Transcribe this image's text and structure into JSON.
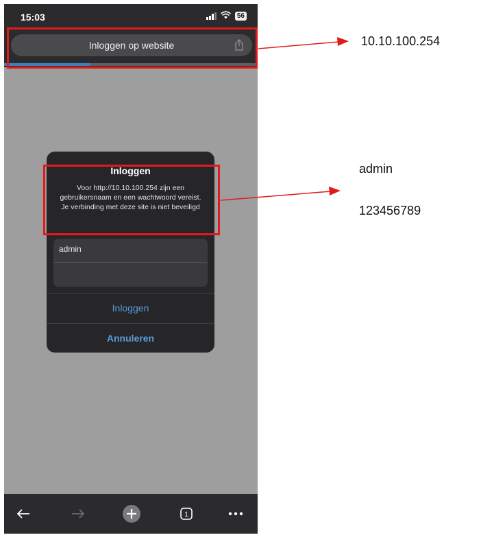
{
  "status_bar": {
    "time": "15:03",
    "battery": "56"
  },
  "browser": {
    "page_title": "Inloggen op website",
    "load_progress": 0.34,
    "tab_count": "1"
  },
  "dialog": {
    "title": "Inloggen",
    "message": "Voor http://10.10.100.254 zijn een gebruikersnaam en een wachtwoord vereist. Je verbinding met deze site is niet beveiligd",
    "username_value": "admin",
    "password_value": "",
    "login_button": "Inloggen",
    "cancel_button": "Annuleren"
  },
  "toolbar": {
    "icons": [
      "back-arrow-icon",
      "forward-arrow-icon",
      "plus-icon",
      "tabs-icon",
      "more-icon"
    ]
  },
  "annotations": {
    "url_note": "10.10.100.254",
    "username_note": "admin",
    "password_note": "123456789",
    "color": "#e11b1b"
  },
  "colors": {
    "accent_blue": "#5b9bd9",
    "dialog_bg": "#262629",
    "chrome_bg": "#2b2b2d"
  }
}
